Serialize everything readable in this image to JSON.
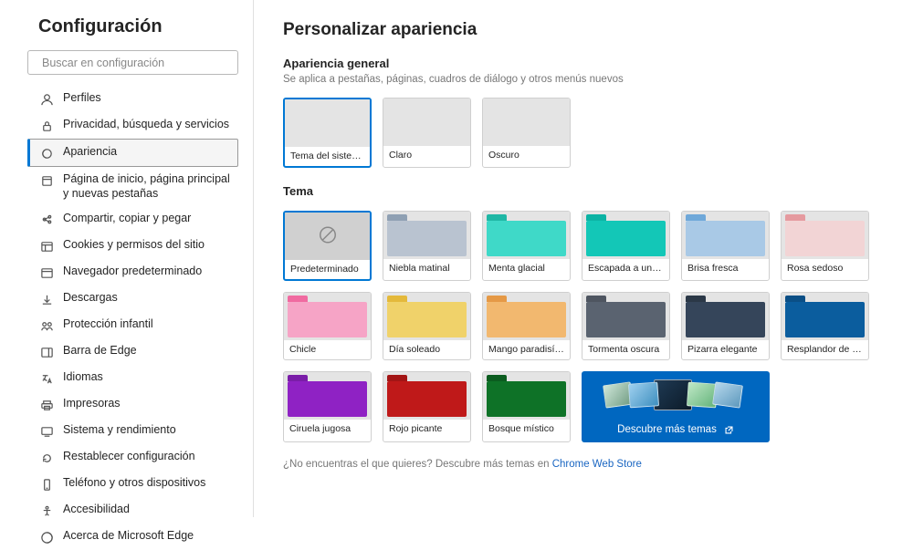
{
  "sidebar": {
    "title": "Configuración",
    "search_placeholder": "Buscar en configuración",
    "items": [
      {
        "icon": "profile",
        "label": "Perfiles"
      },
      {
        "icon": "lock",
        "label": "Privacidad, búsqueda y servicios"
      },
      {
        "icon": "appearance",
        "label": "Apariencia",
        "active": true
      },
      {
        "icon": "home",
        "label": "Página de inicio, página principal y nuevas pestañas"
      },
      {
        "icon": "share",
        "label": "Compartir, copiar y pegar"
      },
      {
        "icon": "cookies",
        "label": "Cookies y permisos del sitio"
      },
      {
        "icon": "browser",
        "label": "Navegador predeterminado"
      },
      {
        "icon": "download",
        "label": "Descargas"
      },
      {
        "icon": "family",
        "label": "Protección infantil"
      },
      {
        "icon": "edgebar",
        "label": "Barra de Edge"
      },
      {
        "icon": "languages",
        "label": "Idiomas"
      },
      {
        "icon": "printer",
        "label": "Impresoras"
      },
      {
        "icon": "system",
        "label": "Sistema y rendimiento"
      },
      {
        "icon": "reset",
        "label": "Restablecer configuración"
      },
      {
        "icon": "phone",
        "label": "Teléfono y otros dispositivos"
      },
      {
        "icon": "accessibility",
        "label": "Accesibilidad"
      },
      {
        "icon": "about",
        "label": "Acerca de Microsoft Edge"
      }
    ]
  },
  "main": {
    "heading": "Personalizar apariencia",
    "general": {
      "title": "Apariencia general",
      "subtitle": "Se aplica a pestañas, páginas, cuadros de diálogo y otros menús nuevos",
      "options": [
        {
          "key": "system",
          "label": "Tema del sistema",
          "selected": true
        },
        {
          "key": "light",
          "label": "Claro"
        },
        {
          "key": "dark",
          "label": "Oscuro"
        }
      ]
    },
    "theme": {
      "title": "Tema",
      "options": [
        {
          "key": "default",
          "label": "Predeterminado",
          "tab": "#cfcfcf",
          "body": "#c7c7c7",
          "selected": true
        },
        {
          "key": "niebla",
          "label": "Niebla matinal",
          "tab": "#8fa0b3",
          "body": "#b9c3d0"
        },
        {
          "key": "menta",
          "label": "Menta glacial",
          "tab": "#1fb7a5",
          "body": "#3fd9c8"
        },
        {
          "key": "escapada",
          "label": "Escapada a una isla",
          "tab": "#0cb3a4",
          "body": "#13c7b7"
        },
        {
          "key": "brisa",
          "label": "Brisa fresca",
          "tab": "#6fa8d9",
          "body": "#a9c9e6"
        },
        {
          "key": "rosa",
          "label": "Rosa sedoso",
          "tab": "#e59a9f",
          "body": "#f2d4d5"
        },
        {
          "key": "chicle",
          "label": "Chicle",
          "tab": "#f06aa0",
          "body": "#f6a4c6"
        },
        {
          "key": "dia",
          "label": "Día soleado",
          "tab": "#e4b93b",
          "body": "#f0d26a"
        },
        {
          "key": "mango",
          "label": "Mango paradisíaco",
          "tab": "#e59946",
          "body": "#f2b86f"
        },
        {
          "key": "tormenta",
          "label": "Tormenta oscura",
          "tab": "#4e5560",
          "body": "#5a6370"
        },
        {
          "key": "pizarra",
          "label": "Pizarra elegante",
          "tab": "#2b3847",
          "body": "#35455a"
        },
        {
          "key": "resplandor",
          "label": "Resplandor de luna",
          "tab": "#0b4f86",
          "body": "#0b5d9e"
        },
        {
          "key": "ciruela",
          "label": "Ciruela jugosa",
          "tab": "#7a1da8",
          "body": "#8f22c4"
        },
        {
          "key": "rojo",
          "label": "Rojo picante",
          "tab": "#a31515",
          "body": "#bf1919"
        },
        {
          "key": "bosque",
          "label": "Bosque místico",
          "tab": "#0b5c1f",
          "body": "#0e7227"
        }
      ],
      "discover": "Descubre más temas"
    },
    "footer": {
      "prefix": "¿No encuentras el que quieres? Descubre más temas en ",
      "link": "Chrome Web Store"
    }
  }
}
